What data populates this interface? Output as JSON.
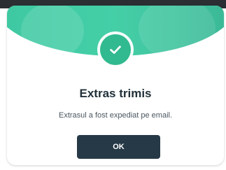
{
  "dialog": {
    "title": "Extras trimis",
    "message": "Extrasul a fost expediat pe email.",
    "ok_label": "OK",
    "icon": "check-icon"
  },
  "colors": {
    "header_green": "#45cfa7",
    "badge_green": "#31b98f",
    "button_navy": "#263947",
    "title_text": "#22313a"
  }
}
